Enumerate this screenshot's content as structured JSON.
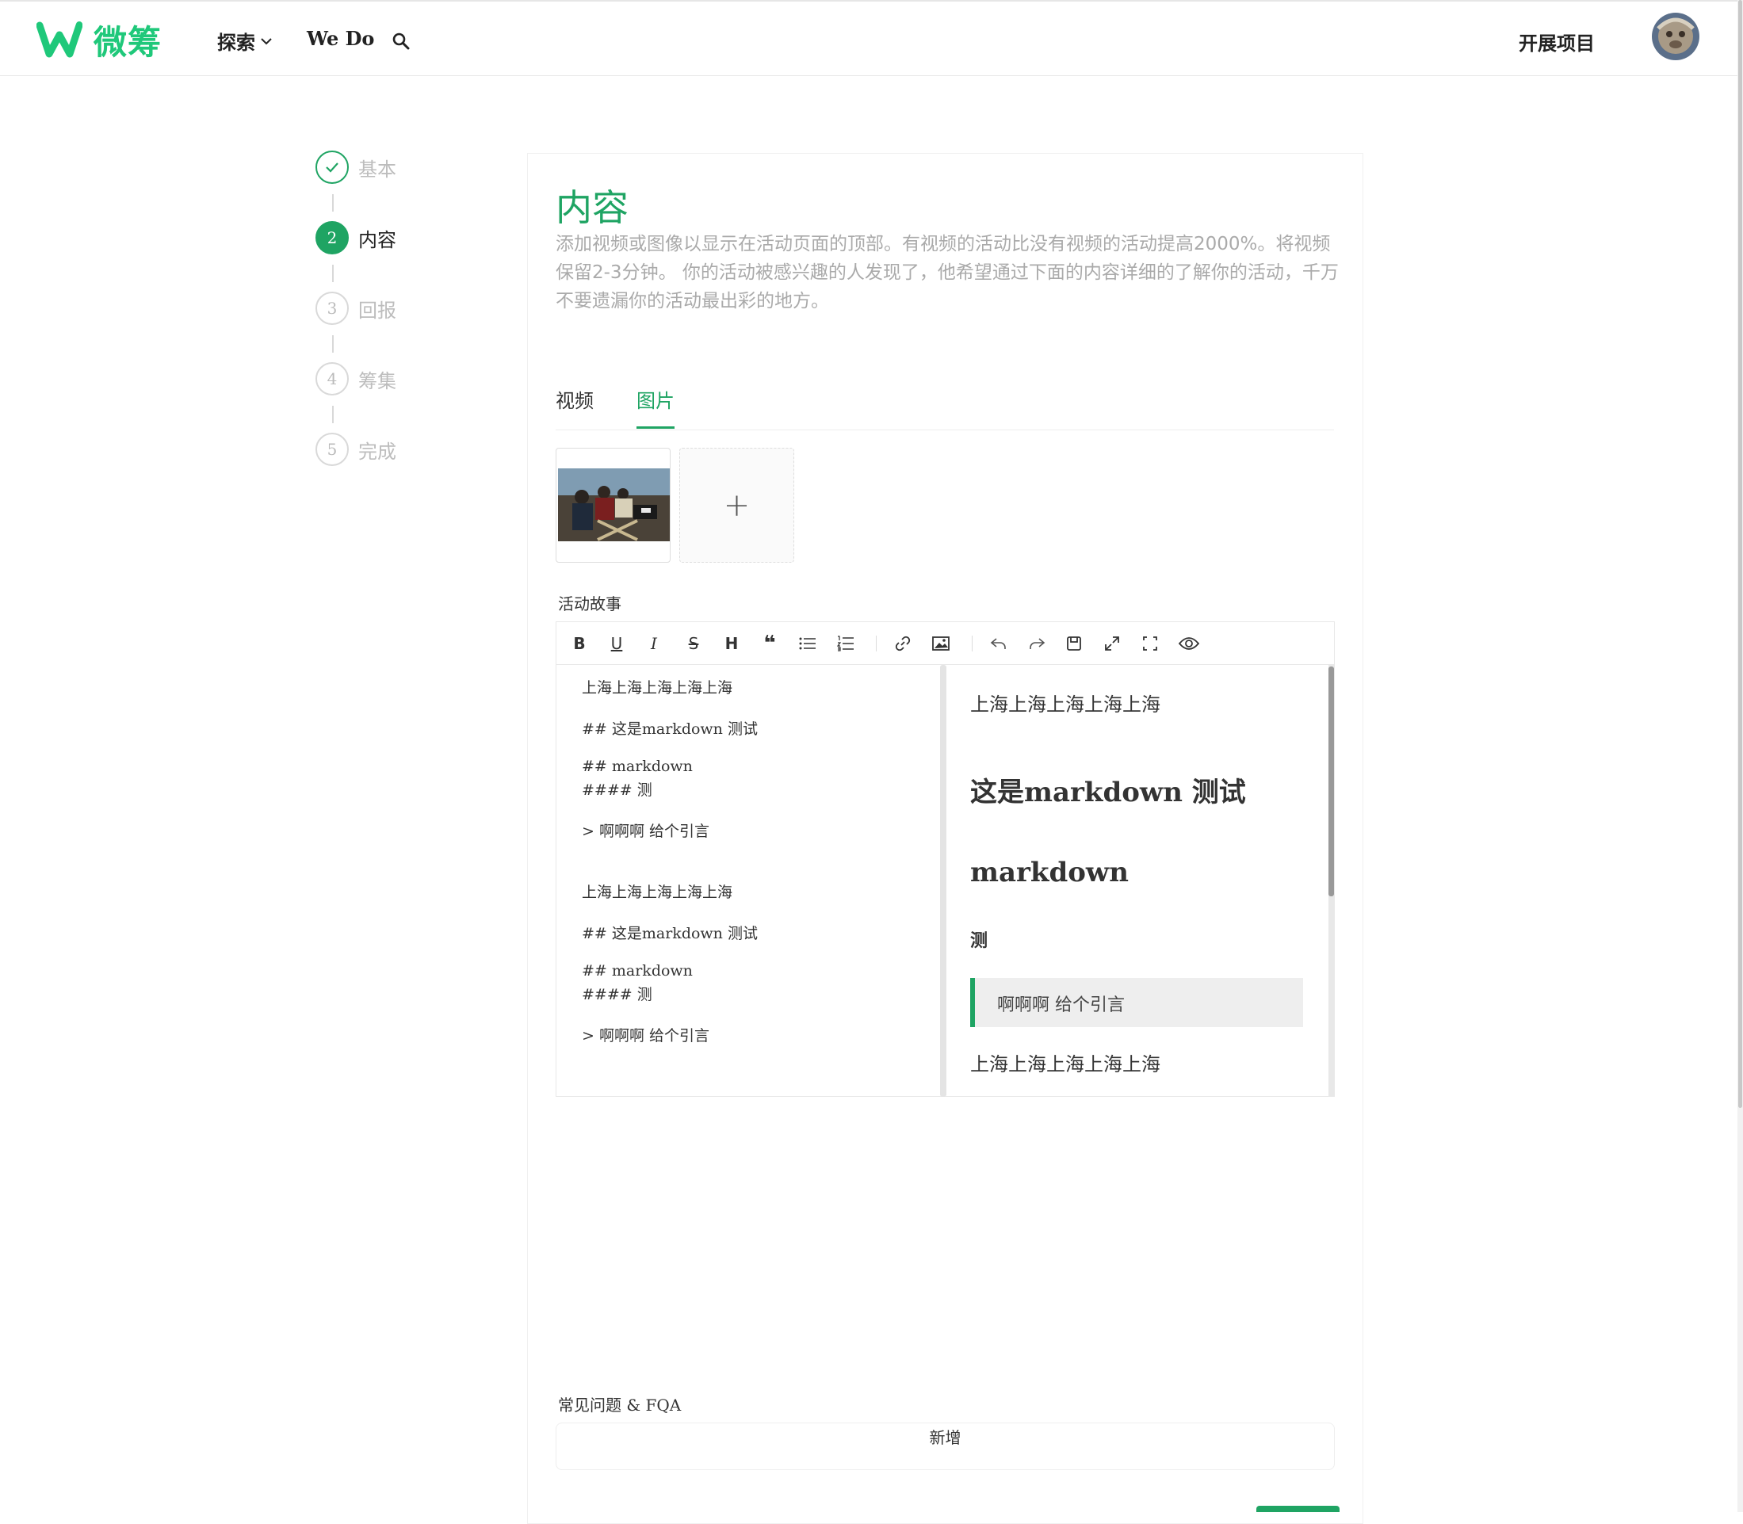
{
  "header": {
    "logo_text": "微筹",
    "nav": {
      "explore": "探索",
      "wedo": "We Do"
    },
    "start_project": "开展项目"
  },
  "steps": [
    {
      "num": "",
      "label": "基本",
      "state": "done"
    },
    {
      "num": "2",
      "label": "内容",
      "state": "active"
    },
    {
      "num": "3",
      "label": "回报",
      "state": "todo"
    },
    {
      "num": "4",
      "label": "筹集",
      "state": "todo"
    },
    {
      "num": "5",
      "label": "完成",
      "state": "todo"
    }
  ],
  "section": {
    "title": "内容",
    "description": "添加视频或图像以显示在活动页面的顶部。有视频的活动比没有视频的活动提高2000%。将视频保留2-3分钟。 你的活动被感兴趣的人发现了，他希望通过下面的内容详细的了解你的活动，千万不要遗漏你的活动最出彩的地方。"
  },
  "tabs": {
    "video": "视频",
    "image": "图片",
    "active": "image"
  },
  "upload": {
    "add": "+"
  },
  "story": {
    "label": "活动故事",
    "toolbar": [
      "bold",
      "underline",
      "italic",
      "strikethrough",
      "heading",
      "quote",
      "unordered-list",
      "ordered-list",
      "link",
      "image",
      "undo",
      "redo",
      "save",
      "fullscreen",
      "fullscreen-exit",
      "preview"
    ],
    "source_lines": [
      "上海上海上海上海上海",
      "## 这是markdown 测试",
      "## markdown",
      "#### 测",
      "> 啊啊啊 给个引言",
      "上海上海上海上海上海",
      "## 这是markdown 测试",
      "## markdown",
      "#### 测",
      "> 啊啊啊 给个引言"
    ],
    "preview": {
      "p1": "上海上海上海上海上海",
      "h2a": "这是markdown 测试",
      "h2b": "markdown",
      "h4": "测",
      "quote": "啊啊啊 给个引言",
      "p2": "上海上海上海上海上海"
    }
  },
  "faq": {
    "label": "常见问题 & FQA",
    "add": "新增"
  },
  "colors": {
    "brand": "#1fa463",
    "logo": "#1fc87a"
  }
}
